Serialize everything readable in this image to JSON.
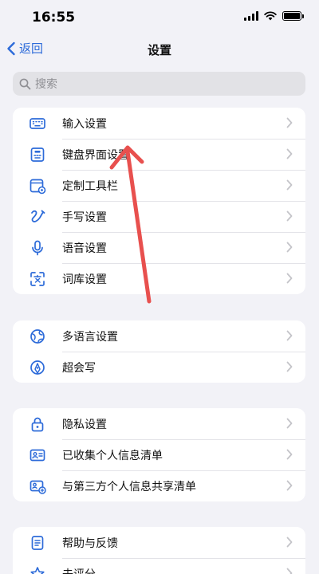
{
  "status_bar": {
    "time": "16:55"
  },
  "nav": {
    "back_label": "返回",
    "title": "设置"
  },
  "search": {
    "placeholder": "搜索"
  },
  "groups": [
    {
      "items": [
        {
          "label": "输入设置",
          "icon": "keyboard-icon"
        },
        {
          "label": "键盘界面设置",
          "icon": "keyboard-layout-icon"
        },
        {
          "label": "定制工具栏",
          "icon": "toolbar-icon"
        },
        {
          "label": "手写设置",
          "icon": "handwriting-icon"
        },
        {
          "label": "语音设置",
          "icon": "microphone-icon"
        },
        {
          "label": "词库设置",
          "icon": "dictionary-icon"
        }
      ]
    },
    {
      "items": [
        {
          "label": "多语言设置",
          "icon": "globe-icon"
        },
        {
          "label": "超会写",
          "icon": "pen-icon"
        }
      ]
    },
    {
      "items": [
        {
          "label": "隐私设置",
          "icon": "lock-icon"
        },
        {
          "label": "已收集个人信息清单",
          "icon": "id-card-icon"
        },
        {
          "label": "与第三方个人信息共享清单",
          "icon": "share-card-icon"
        }
      ]
    },
    {
      "items": [
        {
          "label": "帮助与反馈",
          "icon": "help-icon"
        },
        {
          "label": "去评分",
          "icon": "star-icon"
        }
      ]
    }
  ],
  "colors": {
    "accent": "#2d6bd9",
    "background": "#f2f2f7",
    "annotation_arrow": "#e8504e"
  }
}
